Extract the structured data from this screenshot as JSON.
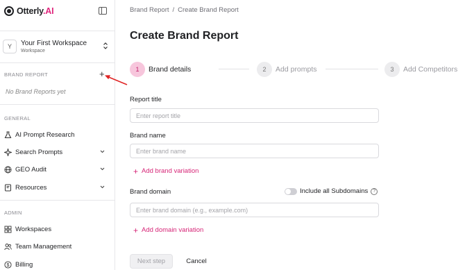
{
  "app": {
    "logo_main": "Otterly",
    "logo_accent": ".AI"
  },
  "workspace": {
    "avatar_letter": "Y",
    "name": "Your First Workspace",
    "subtitle": "Workspace"
  },
  "sidebar": {
    "brand_report_label": "BRAND REPORT",
    "add_report_symbol": "+",
    "empty_note": "No Brand Reports yet",
    "general_label": "GENERAL",
    "general_items": [
      {
        "label": "AI Prompt Research",
        "icon": "flask-icon",
        "expandable": false
      },
      {
        "label": "Search Prompts",
        "icon": "sparkle-icon",
        "expandable": true
      },
      {
        "label": "GEO Audit",
        "icon": "globe-icon",
        "expandable": true
      },
      {
        "label": "Resources",
        "icon": "book-icon",
        "expandable": true
      }
    ],
    "admin_label": "ADMIN",
    "admin_items": [
      {
        "label": "Workspaces",
        "icon": "grid-icon"
      },
      {
        "label": "Team Management",
        "icon": "users-icon"
      },
      {
        "label": "Billing",
        "icon": "dollar-icon"
      }
    ]
  },
  "breadcrumb": {
    "parent": "Brand Report",
    "separator": "/",
    "current": "Create Brand Report"
  },
  "page": {
    "title": "Create Brand Report"
  },
  "stepper": [
    {
      "number": "1",
      "label": "Brand details",
      "state": "active"
    },
    {
      "number": "2",
      "label": "Add prompts",
      "state": "inactive"
    },
    {
      "number": "3",
      "label": "Add Competitors",
      "state": "inactive"
    }
  ],
  "form": {
    "report_title": {
      "label": "Report title",
      "placeholder": "Enter report title",
      "value": ""
    },
    "brand_name": {
      "label": "Brand name",
      "placeholder": "Enter brand name",
      "value": ""
    },
    "add_brand_variation": "Add brand variation",
    "brand_domain": {
      "label": "Brand domain",
      "placeholder": "Enter brand domain (e.g., example.com)",
      "value": ""
    },
    "include_subdomains": {
      "label": "Include all Subdomains",
      "enabled": false,
      "help": "?"
    },
    "add_domain_variation": "Add domain variation"
  },
  "actions": {
    "next": "Next step",
    "cancel": "Cancel"
  },
  "colors": {
    "accent": "#d62577",
    "active_step_bg": "#f7c6dc",
    "annotation_arrow": "#e02424"
  }
}
